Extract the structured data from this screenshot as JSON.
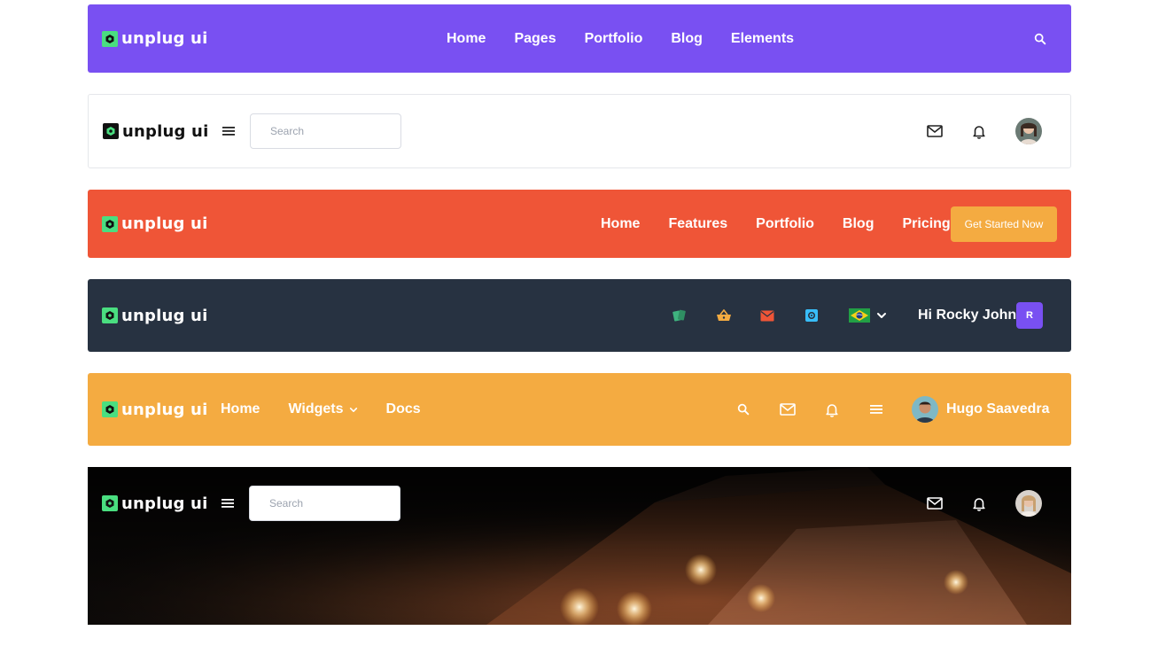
{
  "brand": {
    "name": "unplug ui"
  },
  "colors": {
    "purple": "#7950f2",
    "coral": "#ef5537",
    "navy": "#273241",
    "amber": "#f4ab41",
    "cta": "#f4ab41",
    "logo_green": "#4ade80"
  },
  "bar1": {
    "nav": [
      "Home",
      "Pages",
      "Portfolio",
      "Blog",
      "Elements"
    ],
    "search_icon": "search-icon"
  },
  "bar2": {
    "menu_icon": "hamburger-menu-icon",
    "search_placeholder": "Search",
    "icons": [
      "mail-icon",
      "bell-icon"
    ],
    "avatar": "user-avatar"
  },
  "bar3": {
    "nav": [
      "Home",
      "Features",
      "Portfolio",
      "Blog",
      "Pricing"
    ],
    "cta": "Get Started Now"
  },
  "bar4": {
    "icons": [
      "cards-icon",
      "basket-icon",
      "mail-icon",
      "settings-icon"
    ],
    "language_flag": "brazil-flag-icon",
    "greeting": "Hi Rocky John",
    "badge": "R"
  },
  "bar5": {
    "nav": [
      "Home",
      "Widgets",
      "Docs"
    ],
    "icons": [
      "search-icon",
      "mail-icon",
      "bell-icon",
      "hamburger-menu-icon"
    ],
    "user": "Hugo Saavedra"
  },
  "bar6": {
    "menu_icon": "hamburger-menu-icon",
    "search_placeholder": "Search",
    "icons": [
      "mail-icon",
      "bell-icon"
    ],
    "avatar": "user-avatar"
  }
}
